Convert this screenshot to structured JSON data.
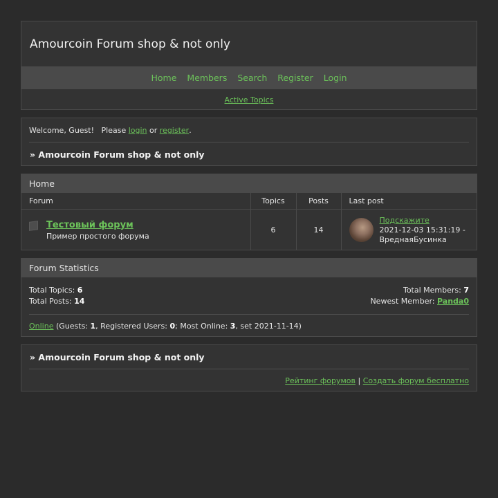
{
  "header": {
    "title": "Amourcoin Forum shop & not only",
    "nav": [
      "Home",
      "Members",
      "Search",
      "Register",
      "Login"
    ],
    "active_topics": "Active Topics"
  },
  "welcome": {
    "prefix": "Welcome, Guest!   Please ",
    "login": "login",
    "or": " or ",
    "register": "register",
    "suffix": ".",
    "breadcrumb": "» Amourcoin Forum shop & not only"
  },
  "forum_table": {
    "category": "Home",
    "columns": {
      "forum": "Forum",
      "topics": "Topics",
      "posts": "Posts",
      "last_post": "Last post"
    },
    "rows": [
      {
        "name": "Тестовый форум",
        "description": "Пример простого форума",
        "topics": "6",
        "posts": "14",
        "last_post_title": "Подскажите",
        "last_post_time": "2021-12-03 15:31:19 -",
        "last_post_author": "ВреднаяБусинка"
      }
    ]
  },
  "stats": {
    "title": "Forum Statistics",
    "total_topics_label": "Total Topics: ",
    "total_topics": "6",
    "total_posts_label": "Total Posts: ",
    "total_posts": "14",
    "total_members_label": "Total Members: ",
    "total_members": "7",
    "newest_member_label": "Newest Member: ",
    "newest_member": "Panda0",
    "online_link": "Online",
    "online_guests_label": " (Guests: ",
    "online_guests": "1",
    "online_registered_label": ", Registered Users: ",
    "online_registered": "0",
    "online_most_label": "; Most Online: ",
    "online_most": "3",
    "online_set": ", set 2021-11-14)"
  },
  "footer": {
    "breadcrumb": "» Amourcoin Forum shop & not only",
    "rating_link": "Рейтинг форумов",
    "separator": " | ",
    "create_link": "Создать форум бесплатно"
  },
  "colors": {
    "background": "#2b2b2b",
    "panel": "#333333",
    "bar": "#4a4a4a",
    "link": "#6cc25a"
  }
}
